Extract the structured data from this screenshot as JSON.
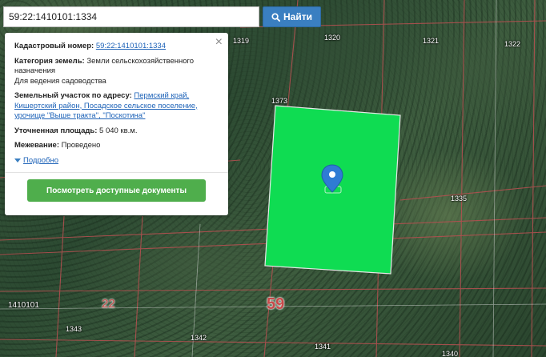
{
  "search": {
    "value": "59:22:1410101:1334",
    "button_label": "Найти"
  },
  "panel": {
    "cadastral_label": "Кадастровый номер:",
    "cadastral_value": "59:22:1410101:1334",
    "category_label": "Категория земель:",
    "category_value": "Земли сельскохозяйственного назначения",
    "usage": "Для ведения садоводства",
    "address_label": "Земельный участок по адресу:",
    "address_value": "Пермский край, Кишертский район, Посадское сельское поселение, урочище \"Выше тракта\", \"Поскотина\"",
    "area_label": "Уточненная площадь:",
    "area_value": "5 040 кв.м.",
    "survey_label": "Межевание:",
    "survey_value": "Проведено",
    "more_label": "Подробно",
    "docs_button_label": "Посмотреть доступные документы"
  },
  "map": {
    "parcel_labels": [
      "1319",
      "1320",
      "1321",
      "1322",
      "1373",
      "1335",
      "1343",
      "1342",
      "1341",
      "1340"
    ],
    "quarter_labels": [
      "22",
      "59"
    ],
    "area_code": "1410101",
    "highlight_color": "#0fdc52",
    "boundary_color": "#b25050",
    "marker_color": "#2f7bd4"
  }
}
